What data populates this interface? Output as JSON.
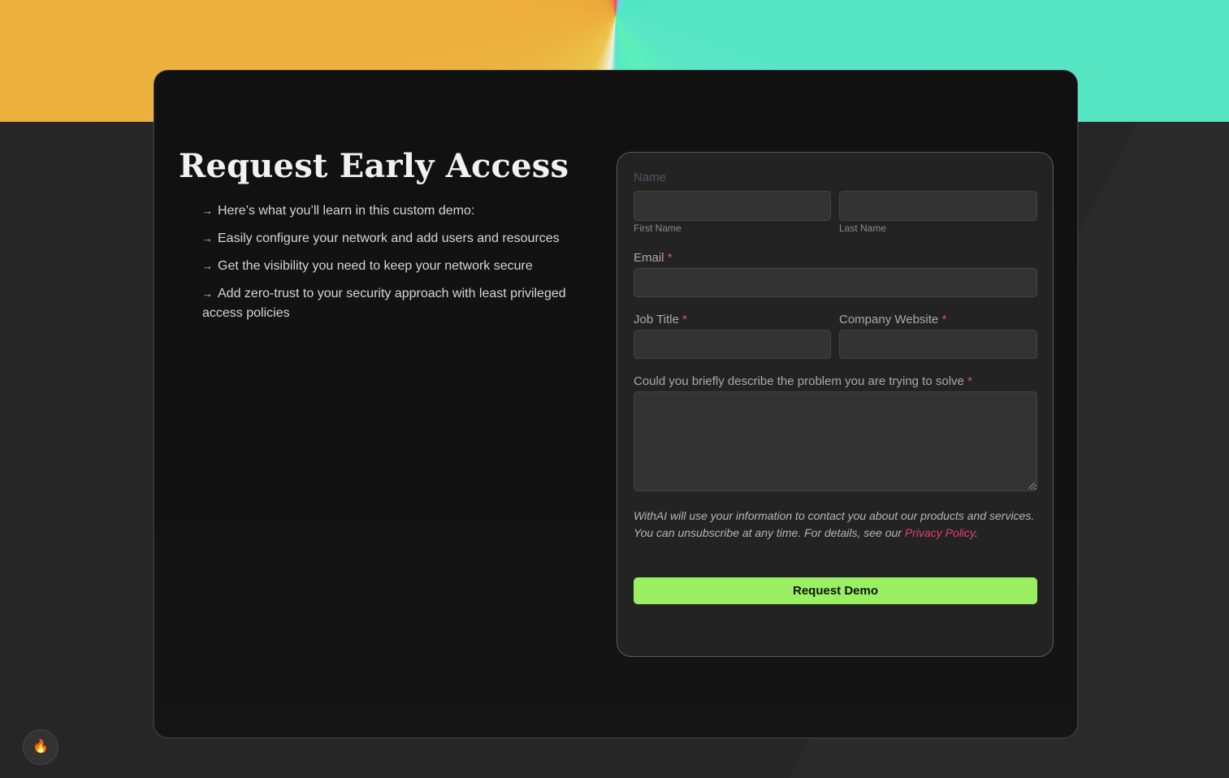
{
  "hero": {
    "title": "Request Early Access",
    "bullets": [
      "Here’s what you’ll learn in this custom demo:",
      "Easily configure your network and add users and resources",
      "Get the visibility you need to keep your network secure",
      "Add zero-trust to your security approach with least privileged access policies"
    ],
    "arrow": "→"
  },
  "form": {
    "name_label": "Name",
    "first_name_label": "First Name",
    "last_name_label": "Last Name",
    "first_name_value": "",
    "last_name_value": "",
    "email_label": "Email",
    "email_value": "",
    "job_title_label": "Job Title",
    "job_title_value": "",
    "company_website_label": "Company Website",
    "company_website_value": "",
    "problem_label": "Could you briefly describe the problem you are trying to solve",
    "problem_value": "",
    "required_marker": "*",
    "disclaimer_text": "WithAI will use your information to contact you about our products and services. You can unsubscribe at any time. For details, see our ",
    "privacy_link_label": "Privacy Policy",
    "disclaimer_end": ".",
    "submit_label": "Request Demo"
  },
  "fab": {
    "icon": "fire-icon",
    "glyph": "🔥"
  },
  "colors": {
    "accent_green": "#9bef62",
    "required_red": "#e0524f",
    "link_pink": "#e0416b",
    "card_bg": "#111111",
    "page_bg": "#262626"
  }
}
